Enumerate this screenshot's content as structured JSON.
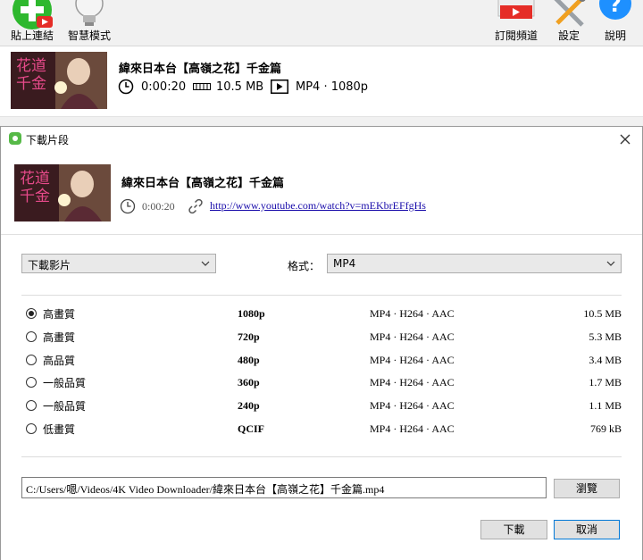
{
  "toolbar": {
    "paste_link": "貼上連結",
    "smart_mode": "智慧模式",
    "subscribe": "訂閱頻道",
    "settings": "設定",
    "help": "說明"
  },
  "app_item": {
    "title": "緯來日本台【高嶺之花】千金篇",
    "duration": "0:00:20",
    "size": "10.5 MB",
    "format": "MP4 · 1080p",
    "thumb_text_a": "花道",
    "thumb_text_b": "千金"
  },
  "dialog": {
    "title": "下載片段",
    "video_title": "緯來日本台【高嶺之花】千金篇",
    "duration": "0:00:20",
    "url": "http://www.youtube.com/watch?v=mEKbrEFfgHs",
    "download_type": "下載影片",
    "format_label": "格式：",
    "format_value": "MP4",
    "qualities": [
      {
        "quality": "高畫質",
        "resolution": "1080p",
        "codec": "MP4 · H264 · AAC",
        "size": "10.5 MB",
        "selected": true
      },
      {
        "quality": "高畫質",
        "resolution": "720p",
        "codec": "MP4 · H264 · AAC",
        "size": "5.3 MB",
        "selected": false
      },
      {
        "quality": "高品質",
        "resolution": "480p",
        "codec": "MP4 · H264 · AAC",
        "size": "3.4 MB",
        "selected": false
      },
      {
        "quality": "一般品質",
        "resolution": "360p",
        "codec": "MP4 · H264 · AAC",
        "size": "1.7 MB",
        "selected": false
      },
      {
        "quality": "一般品質",
        "resolution": "240p",
        "codec": "MP4 · H264 · AAC",
        "size": "1.1 MB",
        "selected": false
      },
      {
        "quality": "低畫質",
        "resolution": "QCIF",
        "codec": "MP4 · H264 · AAC",
        "size": "769 kB",
        "selected": false
      }
    ],
    "save_path": "C:/Users/嗯/Videos/4K Video Downloader/緯來日本台【高嶺之花】千金篇.mp4",
    "browse_label": "瀏覽",
    "download_label": "下載",
    "cancel_label": "取消"
  },
  "colors": {
    "link": "#1a0dab",
    "paste_green": "#2eb82e",
    "subscribe_red": "#e52d27",
    "help_blue": "#1e90ff"
  }
}
